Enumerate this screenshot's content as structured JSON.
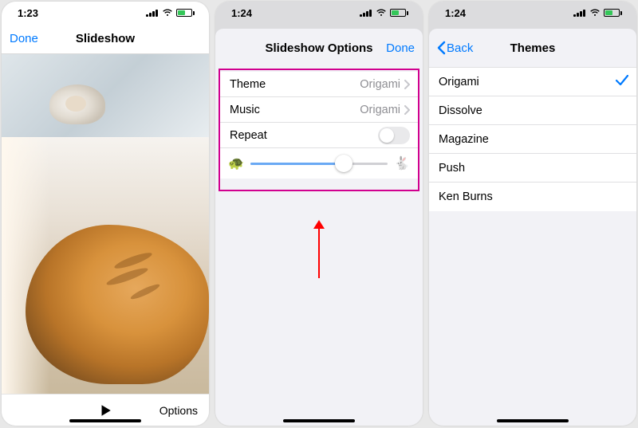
{
  "screen1": {
    "time": "1:23",
    "done": "Done",
    "title": "Slideshow",
    "options": "Options"
  },
  "screen2": {
    "time": "1:24",
    "title": "Slideshow Options",
    "done": "Done",
    "rows": {
      "theme_label": "Theme",
      "theme_value": "Origami",
      "music_label": "Music",
      "music_value": "Origami",
      "repeat_label": "Repeat"
    },
    "repeat_on": false,
    "speed_percent": 68
  },
  "screen3": {
    "time": "1:24",
    "back": "Back",
    "title": "Themes",
    "items": [
      "Origami",
      "Dissolve",
      "Magazine",
      "Push",
      "Ken Burns"
    ],
    "selected": "Origami"
  }
}
